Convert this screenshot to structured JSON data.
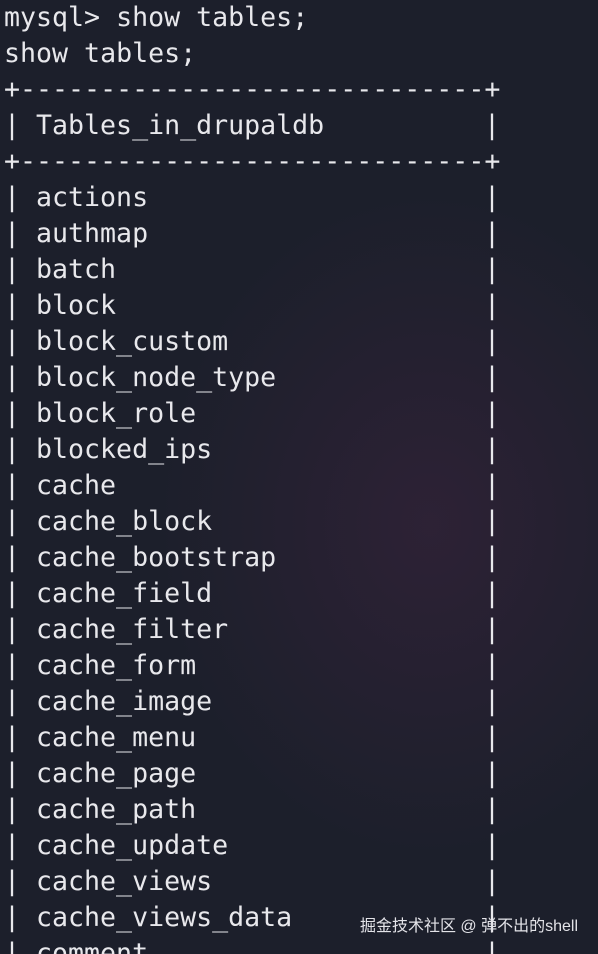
{
  "terminal": {
    "prompt_line": "mysql> show tables;",
    "echo_line": "show tables;",
    "border": "+-----------------------------+",
    "header": "Tables_in_drupaldb",
    "left_bar": "|",
    "right_bar": "|",
    "rows": [
      "actions",
      "authmap",
      "batch",
      "block",
      "block_custom",
      "block_node_type",
      "block_role",
      "blocked_ips",
      "cache",
      "cache_block",
      "cache_bootstrap",
      "cache_field",
      "cache_filter",
      "cache_form",
      "cache_image",
      "cache_menu",
      "cache_page",
      "cache_path",
      "cache_update",
      "cache_views",
      "cache_views_data",
      "comment"
    ]
  },
  "watermark": "掘金技术社区 @ 弹不出的shell",
  "colors": {
    "background": "#1c1f2b",
    "text": "#e8e8ec"
  }
}
